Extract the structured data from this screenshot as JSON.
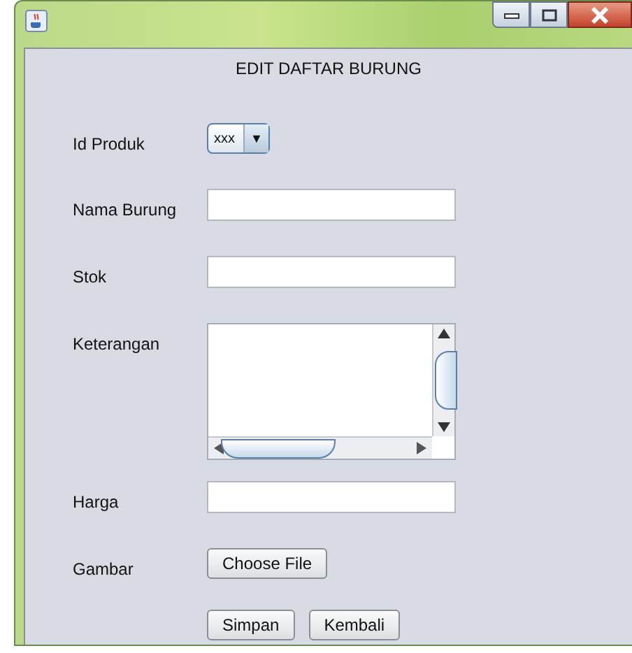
{
  "form": {
    "title": "EDIT DAFTAR BURUNG",
    "fields": [
      {
        "label": "Id Produk",
        "kind": "dropdown",
        "value": "xxx",
        "arrow": "▼"
      },
      {
        "label": "Nama Burung",
        "kind": "text"
      },
      {
        "label": "Stok",
        "kind": "text"
      },
      {
        "label": "Keterangan",
        "kind": "textarea"
      },
      {
        "label": "Harga",
        "kind": "text"
      },
      {
        "label": "Gambar",
        "kind": "file",
        "button": "Choose File"
      }
    ]
  },
  "buttons": [
    "Simpan",
    "Kembali"
  ]
}
